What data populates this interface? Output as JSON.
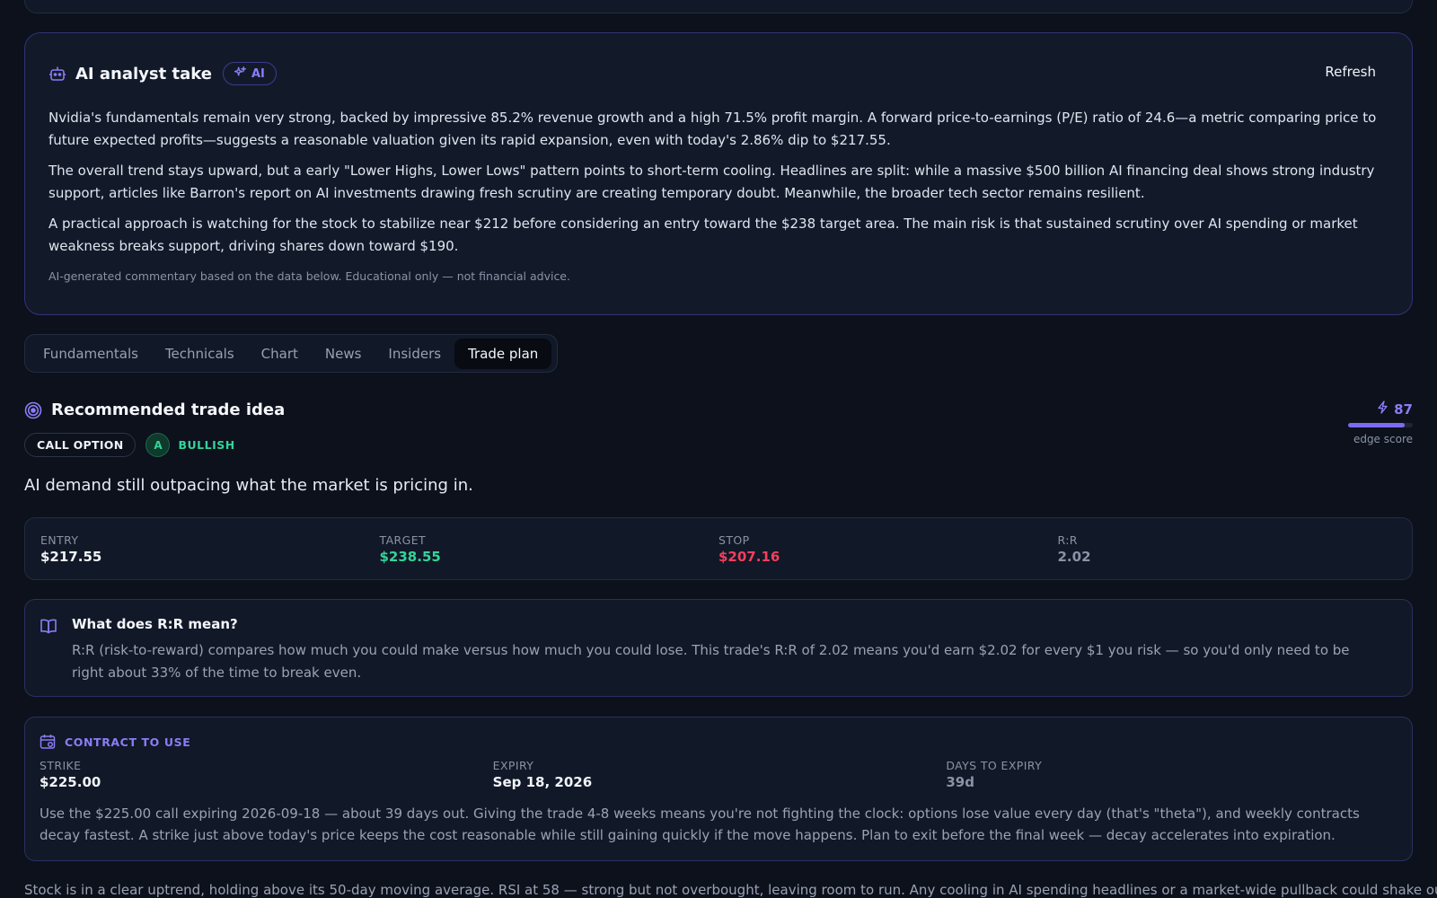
{
  "ai_card": {
    "title": "AI analyst take",
    "badge": "AI",
    "refresh_label": "Refresh",
    "paragraphs": [
      "Nvidia's fundamentals remain very strong, backed by impressive 85.2% revenue growth and a high 71.5% profit margin. A forward price-to-earnings (P/E) ratio of 24.6—a metric comparing price to future expected profits—suggests a reasonable valuation given its rapid expansion, even with today's 2.86% dip to $217.55.",
      "The overall trend stays upward, but a early \"Lower Highs, Lower Lows\" pattern points to short-term cooling. Headlines are split: while a massive $500 billion AI financing deal shows strong industry support, articles like Barron's report on AI investments drawing fresh scrutiny are creating temporary doubt. Meanwhile, the broader tech sector remains resilient.",
      "A practical approach is watching for the stock to stabilize near $212 before considering an entry toward the $238 target area. The main risk is that sustained scrutiny over AI spending or market weakness breaks support, driving shares down toward $190."
    ],
    "disclaimer": "AI-generated commentary based on the data below. Educational only — not financial advice.",
    "icon": "robot-icon",
    "badge_icon": "sparkle-icon"
  },
  "tabs": [
    {
      "label": "Fundamentals"
    },
    {
      "label": "Technicals"
    },
    {
      "label": "Chart"
    },
    {
      "label": "News"
    },
    {
      "label": "Insiders"
    },
    {
      "label": "Trade plan",
      "active": true
    }
  ],
  "trade_idea": {
    "title": "Recommended trade idea",
    "icon": "target-icon",
    "type_pill": "CALL OPTION",
    "grade": "A",
    "sentiment": "BULLISH",
    "thesis": "AI demand still outpacing what the market is pricing in.",
    "edge": {
      "score": "87",
      "label": "edge score",
      "fraction": 0.87,
      "icon": "bolt-icon"
    }
  },
  "levels": [
    {
      "label": "ENTRY",
      "value": "$217.55",
      "color": "#f1f4fa"
    },
    {
      "label": "TARGET",
      "value": "$238.55",
      "color": "#34d399"
    },
    {
      "label": "STOP",
      "value": "$207.16",
      "color": "#f43f5e"
    },
    {
      "label": "R:R",
      "value": "2.02",
      "color": "#8a93a6"
    }
  ],
  "rr_explainer": {
    "icon": "book-icon",
    "title": "What does R:R mean?",
    "body": "R:R (risk-to-reward) compares how much you could make versus how much you could lose. This trade's R:R of 2.02 means you'd earn $2.02 for every $1 you risk — so you'd only need to be right about 33% of the time to break even."
  },
  "contract": {
    "icon": "calendar-icon",
    "label": "CONTRACT TO USE",
    "strike_label": "STRIKE",
    "strike": "$225.00",
    "expiry_label": "EXPIRY",
    "expiry": "Sep 18, 2026",
    "dte_label": "DAYS TO EXPIRY",
    "dte": "39d",
    "body": "Use the $225.00 call expiring 2026-09-18 — about 39 days out. Giving the trade 4-8 weeks means you're not fighting the clock: options lose value every day (that's \"theta\"), and weekly contracts decay fastest. A strike just above today's price keeps the cost reasonable while still gaining quickly if the move happens. Plan to exit before the final week — decay accelerates into expiration."
  },
  "footer_text": "Stock is in a clear uptrend, holding above its 50-day moving average. RSI at 58 — strong but not overbought, leaving room to run. Any cooling in AI spending headlines or a market-wide pullback could shake out",
  "colors": {
    "accent": "#8b7cf6",
    "positive": "#34d399",
    "negative": "#f43f5e",
    "background": "#0c111c"
  }
}
